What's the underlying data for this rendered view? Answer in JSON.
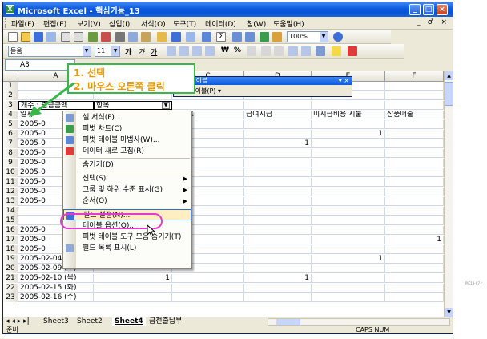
{
  "window": {
    "title": "Microsoft Excel - 핵심기능_13",
    "app_icon": "excel-icon",
    "controls": [
      "minimize",
      "maximize",
      "close"
    ]
  },
  "menubar": {
    "items": [
      "파일(F)",
      "편집(E)",
      "보기(V)",
      "삽입(I)",
      "서식(O)",
      "도구(T)",
      "데이터(D)",
      "창(W)",
      "도움말(H)"
    ],
    "mdi_controls": "_ ♂ ×"
  },
  "toolbar_standard": {
    "zoom": "100%"
  },
  "toolbar_format": {
    "font": "돋움",
    "size": "11",
    "bold": "가",
    "italic": "가",
    "underline": "가",
    "currency": "₩",
    "percent": "%"
  },
  "formula_bar": {
    "name_box": "A3"
  },
  "grid": {
    "columns": [
      "A",
      "B",
      "C",
      "D",
      "E",
      "F"
    ],
    "rows": [
      {
        "n": "1",
        "a": "",
        "b": "",
        "c": "",
        "d": "",
        "e": "",
        "f": ""
      },
      {
        "n": "2",
        "a": "",
        "b": "",
        "c": "",
        "d": "",
        "e": "",
        "f": ""
      },
      {
        "n": "3",
        "a": "개수 : 출금금액",
        "b": "항목",
        "c": "",
        "d": "",
        "e": "",
        "f": ""
      },
      {
        "n": "4",
        "a": "일자",
        "b": "",
        "c": "보험료",
        "d": "급여지급",
        "e": "미지급비용 지불",
        "f": "상품매출"
      },
      {
        "n": "5",
        "a": "2005-0",
        "b": "",
        "c": "",
        "d": "",
        "e": "",
        "f": ""
      },
      {
        "n": "6",
        "a": "2005-0",
        "b": "",
        "c": "",
        "d": "",
        "e": "1",
        "f": ""
      },
      {
        "n": "7",
        "a": "2005-0",
        "b": "",
        "c": "",
        "d": "1",
        "e": "",
        "f": ""
      },
      {
        "n": "8",
        "a": "2005-0",
        "b": "",
        "c": "",
        "d": "",
        "e": "",
        "f": ""
      },
      {
        "n": "9",
        "a": "2005-0",
        "b": "",
        "c": "",
        "d": "",
        "e": "",
        "f": ""
      },
      {
        "n": "10",
        "a": "2005-0",
        "b": "",
        "c": "",
        "d": "",
        "e": "",
        "f": ""
      },
      {
        "n": "11",
        "a": "2005-0",
        "b": "",
        "c": "",
        "d": "",
        "e": "",
        "f": ""
      },
      {
        "n": "12",
        "a": "2005-0",
        "b": "",
        "c": "",
        "d": "",
        "e": "",
        "f": ""
      },
      {
        "n": "13",
        "a": "2005-0",
        "b": "",
        "c": "",
        "d": "",
        "e": "",
        "f": ""
      },
      {
        "n": "14",
        "a": "2005",
        "b": "",
        "c": "",
        "d": "",
        "e": "",
        "f": ""
      },
      {
        "n": "15",
        "a": "2005",
        "b": "",
        "c": "",
        "d": "",
        "e": "",
        "f": ""
      },
      {
        "n": "16",
        "a": "2005-0",
        "b": "",
        "c": "",
        "d": "",
        "e": "",
        "f": ""
      },
      {
        "n": "17",
        "a": "2005-0",
        "b": "",
        "c": "",
        "d": "",
        "e": "",
        "f": "1"
      },
      {
        "n": "18",
        "a": "2005-0",
        "b": "",
        "c": "",
        "d": "",
        "e": "",
        "f": ""
      },
      {
        "n": "19",
        "a": "2005-02-04 (금)",
        "b": "",
        "c": "",
        "d": "",
        "e": "1",
        "f": ""
      },
      {
        "n": "20",
        "a": "2005-02-09 (수)",
        "b": "",
        "c": "",
        "d": "",
        "e": "",
        "f": ""
      },
      {
        "n": "21",
        "a": "2005-02-10 (목)",
        "b": "1",
        "c": "",
        "d": "1",
        "e": "",
        "f": ""
      },
      {
        "n": "22",
        "a": "2005-02-15 (화)",
        "b": "",
        "c": "",
        "d": "",
        "e": "",
        "f": ""
      },
      {
        "n": "23",
        "a": "2005-02-16 (수)",
        "b": "",
        "c": "",
        "d": "",
        "e": "",
        "f": ""
      }
    ]
  },
  "pivot_toolbar": {
    "title": "피벗 테이블",
    "menu": "피벗 테이블(P) ▾"
  },
  "context_menu": {
    "items": [
      {
        "label": "셀 서식(F)...",
        "icon": "format-cells-icon",
        "submenu": false
      },
      {
        "label": "피벗 차트(C)",
        "icon": "pivot-chart-icon",
        "submenu": false
      },
      {
        "label": "피벗 테이블 마법사(W)...",
        "icon": "pivot-wizard-icon",
        "submenu": false
      },
      {
        "label": "데이터 새로 고침(R)",
        "icon": "refresh-data-icon",
        "submenu": false
      },
      {
        "label": "숨기기(D)",
        "icon": "",
        "submenu": false
      },
      {
        "label": "선택(S)",
        "icon": "",
        "submenu": true
      },
      {
        "label": "그룹 및 하위 수준 표시(G)",
        "icon": "",
        "submenu": true
      },
      {
        "label": "순서(O)",
        "icon": "",
        "submenu": true
      },
      {
        "label": "필드 설정(N)...",
        "icon": "field-settings-icon",
        "submenu": false
      },
      {
        "label": "테이블 옵션(O)...",
        "icon": "",
        "submenu": false
      },
      {
        "label": "피벗 테이블 도구 모음 숨기기(T)",
        "icon": "",
        "submenu": false
      },
      {
        "label": "필드 목록 표시(L)",
        "icon": "field-list-icon",
        "submenu": false
      }
    ],
    "highlighted": "필드 설정(N)..."
  },
  "callout": {
    "line1": "1. 선택",
    "line2": "2. 마우스 오른쪽 클릭"
  },
  "sheet_tabs": {
    "nav": "◂ ◂ ▸ ▸|",
    "tabs": [
      "Sheet3",
      "Sheet2",
      "Sheet4",
      "금전출납부"
    ],
    "active": "Sheet4"
  },
  "status_bar": {
    "left": "준비",
    "caps": "CAPS NUM"
  },
  "side_caption": "PIC13-07 /",
  "colors": {
    "title_bar": "#0c5ae0",
    "callout_border": "#39b84a",
    "callout_text": "#e89a00",
    "highlight_ring": "#e33ad2",
    "menu_highlight": "#ffeec2"
  }
}
